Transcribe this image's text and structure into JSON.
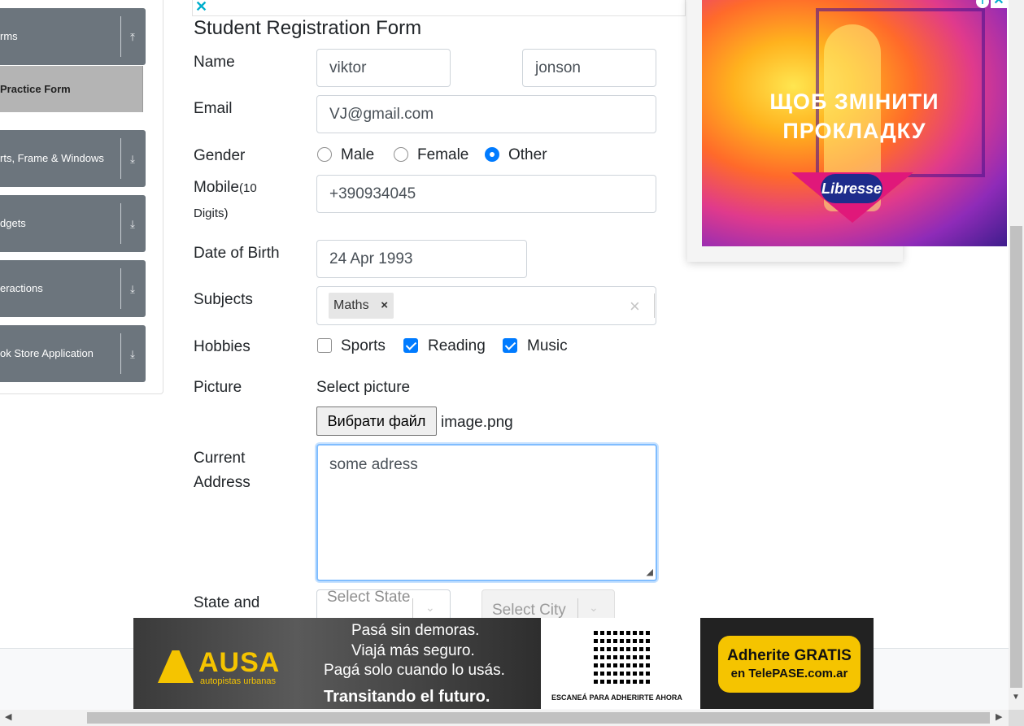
{
  "sidebar": {
    "groups": [
      {
        "label": "rms"
      },
      {
        "label": "rts, Frame & Windows"
      },
      {
        "label": "dgets"
      },
      {
        "label": "eractions"
      },
      {
        "label": "ok Store Application"
      }
    ],
    "active_item": "Practice Form"
  },
  "form": {
    "title": "Student Registration Form",
    "name": {
      "label": "Name",
      "first": "viktor",
      "last": "jonson"
    },
    "email": {
      "label": "Email",
      "value": "VJ@gmail.com"
    },
    "gender": {
      "label": "Gender",
      "options": [
        "Male",
        "Female",
        "Other"
      ],
      "selected": "Other"
    },
    "mobile": {
      "label": "Mobile",
      "hint_1": "(10",
      "hint_2": "Digits)",
      "value": "+390934045"
    },
    "dob": {
      "label": "Date of Birth",
      "value": "24 Apr 1993"
    },
    "subjects": {
      "label": "Subjects",
      "chips": [
        "Maths"
      ],
      "chip_remove": "×",
      "clear": "×"
    },
    "hobbies": {
      "label": "Hobbies",
      "options": [
        "Sports",
        "Reading",
        "Music"
      ],
      "checked": [
        "Reading",
        "Music"
      ]
    },
    "picture": {
      "label": "Picture",
      "prompt": "Select picture",
      "button": "Вибрати файл",
      "file_name": "image.png"
    },
    "address": {
      "label_1": "Current",
      "label_2": "Address",
      "value": "some adress"
    },
    "state_city": {
      "label": "State and",
      "state_placeholder": "Select State",
      "city_placeholder": "Select City"
    }
  },
  "right_ad": {
    "line_1": "ЩОБ ЗМІНИТИ",
    "line_2": "ПРОКЛАДКУ",
    "brand": "Libresse",
    "info": "i",
    "close": "✕"
  },
  "top_ad": {
    "close": "✕"
  },
  "bottom_ad": {
    "logo": "AUSA",
    "logo_sub": "autopistas urbanas",
    "lines": [
      "Pasá sin demoras.",
      "Viajá más seguro.",
      "Pagá solo cuando lo usás."
    ],
    "tagline": "Transitando el futuro.",
    "qr_caption": "ESCANEÁ PARA ADHERIRTE AHORA",
    "cta_1": "Adherite GRATIS",
    "cta_2": "en TelePASE.com.ar"
  },
  "icons": {
    "expand": "⤓",
    "collapse": "⤒",
    "chevron_down": "⌄",
    "scroll_left": "◀",
    "scroll_right": "▶",
    "scroll_down": "▼",
    "resize": "◢"
  },
  "colors": {
    "primary": "#007bff",
    "sidebar_group": "#6c757d",
    "sidebar_active": "#b4b4b4",
    "ad_accent": "#00aecd"
  }
}
